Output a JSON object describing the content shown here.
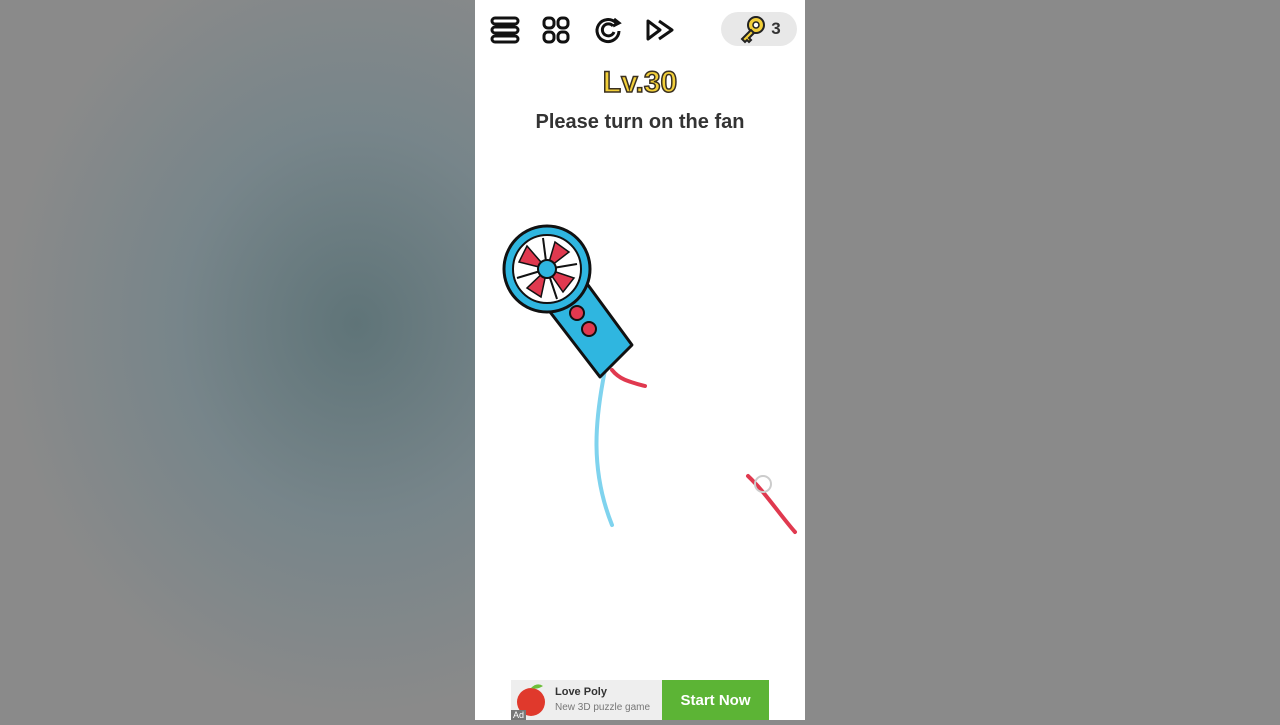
{
  "toolbar": {
    "icons": [
      "menu-icon",
      "levels-grid-icon",
      "restart-icon",
      "skip-icon"
    ],
    "keys_count": "3"
  },
  "level": {
    "label": "Lv.30",
    "prompt": "Please turn on the fan"
  },
  "colors": {
    "level": "#f2cf3a",
    "fan_body": "#2fb6e0",
    "fan_blades": "#e0394f",
    "wire_blue": "#7fd3ee",
    "wire_red": "#e0394f",
    "ad_button": "#5cb435"
  },
  "ad": {
    "title": "Love Poly",
    "subtitle": "New 3D puzzle game",
    "button": "Start Now",
    "tag": "Ad"
  }
}
